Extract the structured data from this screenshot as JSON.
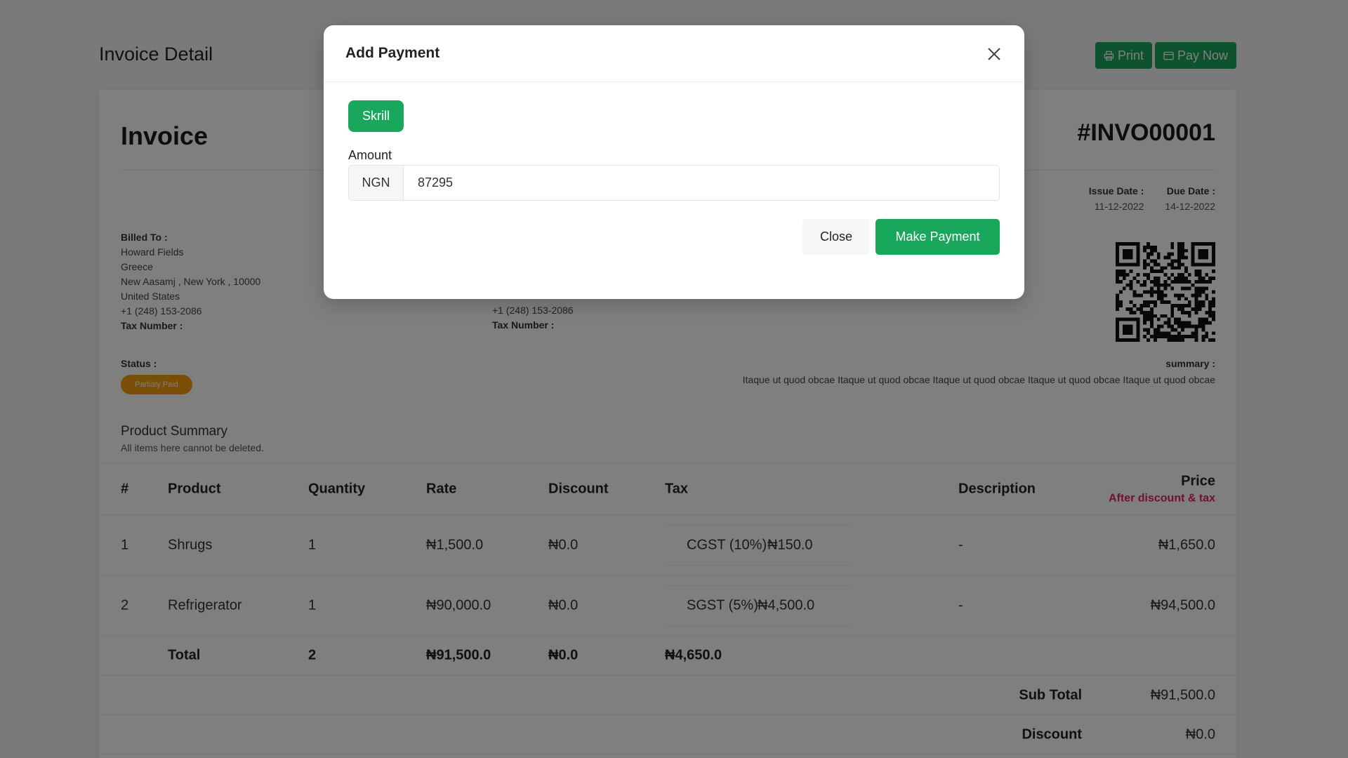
{
  "page": {
    "title": "Invoice Detail",
    "print_label": "Print",
    "pay_now_label": "Pay Now"
  },
  "invoice": {
    "heading": "Invoice",
    "number": "#INVO00001",
    "issue_date_label": "Issue Date :",
    "issue_date": "11-12-2022",
    "due_date_label": "Due Date :",
    "due_date": "14-12-2022",
    "billed_to": {
      "label": "Billed To :",
      "name": "Howard Fields",
      "country_line1": "Greece",
      "address": "New Aasamj , New York , 10000",
      "country_line2": "United States",
      "phone": "+1 (248) 153-2086",
      "tax_label": "Tax Number :"
    },
    "shipped_to": {
      "phone": "+1 (248) 153-2086",
      "tax_label": "Tax Number :"
    },
    "status_label": "Status :",
    "status": "Partialy Paid",
    "summary_label": "summary :",
    "summary": "Itaque ut quod obcae Itaque ut quod obcae Itaque ut quod obcae Itaque ut quod obcae Itaque ut quod obcae",
    "product_summary_title": "Product Summary",
    "product_summary_sub": "All items here cannot be deleted."
  },
  "table": {
    "headers": {
      "num": "#",
      "product": "Product",
      "quantity": "Quantity",
      "rate": "Rate",
      "discount": "Discount",
      "tax": "Tax",
      "description": "Description",
      "price": "Price",
      "price_sub": "After discount & tax"
    },
    "rows": [
      {
        "num": "1",
        "product": "Shrugs",
        "quantity": "1",
        "rate": "₦1,500.0",
        "discount": "₦0.0",
        "tax_name": "CGST (10%)",
        "tax_amount": "₦150.0",
        "description": "-",
        "price": "₦1,650.0"
      },
      {
        "num": "2",
        "product": "Refrigerator",
        "quantity": "1",
        "rate": "₦90,000.0",
        "discount": "₦0.0",
        "tax_name": "SGST (5%)",
        "tax_amount": "₦4,500.0",
        "description": "-",
        "price": "₦94,500.0"
      }
    ],
    "total": {
      "label": "Total",
      "quantity": "2",
      "rate": "₦91,500.0",
      "discount": "₦0.0",
      "tax": "₦4,650.0"
    },
    "sub_total_label": "Sub Total",
    "sub_total": "₦91,500.0",
    "discount_label": "Discount",
    "discount": "₦0.0"
  },
  "modal": {
    "title": "Add Payment",
    "gateway_label": "Skrill",
    "amount_label": "Amount",
    "currency": "NGN",
    "amount_value": "87295",
    "close_label": "Close",
    "submit_label": "Make Payment"
  },
  "colors": {
    "brand_green": "#19a75c",
    "status_orange": "#f59e0b",
    "price_sub_red": "#e5245b"
  }
}
